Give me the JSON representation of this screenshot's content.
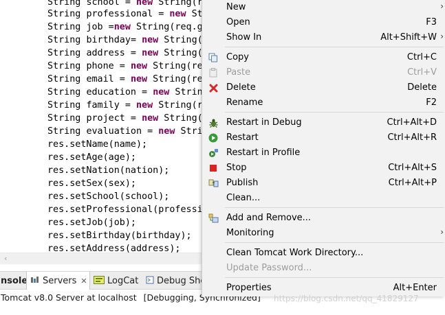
{
  "editor": {
    "lines": [
      {
        "type": "String",
        "name": "school",
        "rest": " = ",
        "kw": "new",
        "tail": " String(r"
      },
      {
        "type": "String",
        "name": "professional",
        "rest": " = ",
        "kw": "new",
        "tail": " St"
      },
      {
        "type": "String",
        "name": "job",
        "rest": " =",
        "kw": "new",
        "tail": " String(req.g"
      },
      {
        "type": "String",
        "name": "birthday",
        "rest": "= ",
        "kw": "new",
        "tail": " String("
      },
      {
        "type": "String",
        "name": "address",
        "rest": " = ",
        "kw": "new",
        "tail": " String("
      },
      {
        "type": "String",
        "name": "phone",
        "rest": " = ",
        "kw": "new",
        "tail": " String(re"
      },
      {
        "type": "String",
        "name": "email",
        "rest": " = ",
        "kw": "new",
        "tail": " String(re"
      },
      {
        "type": "String",
        "name": "education",
        "rest": " = ",
        "kw": "new",
        "tail": " Strin"
      },
      {
        "type": "String",
        "name": "family",
        "rest": " = ",
        "kw": "new",
        "tail": " String(r"
      },
      {
        "type": "String",
        "name": "project",
        "rest": " = ",
        "kw": "new",
        "tail": " String("
      },
      {
        "type": "String",
        "name": "evaluation",
        "rest": " = ",
        "kw": "new",
        "tail": " Stri"
      }
    ],
    "calls": [
      "res.setName(name);",
      "res.setAge(age);",
      "res.setNation(nation);",
      "res.setSex(sex);",
      "res.setSchool(school);",
      "res.setProfessional(professi",
      "res.setJob(job);",
      "res.setBirthday(birthday);",
      "res.setAddress(address);"
    ]
  },
  "tabs": {
    "console": "nsole",
    "servers": "Servers",
    "servers_close": "✕",
    "logcat": "LogCat",
    "debug": "Debug She"
  },
  "status": {
    "server": "Tomcat v8.0 Server at localhost",
    "state": "[Debugging, Synchronized]"
  },
  "menu": {
    "new": {
      "label": "New"
    },
    "open": {
      "label": "Open",
      "accel": "F3"
    },
    "show_in": {
      "label": "Show In",
      "accel": "Alt+Shift+W"
    },
    "copy": {
      "label": "Copy",
      "accel": "Ctrl+C"
    },
    "paste": {
      "label": "Paste",
      "accel": "Ctrl+V"
    },
    "delete": {
      "label": "Delete",
      "accel": "Delete"
    },
    "rename": {
      "label": "Rename",
      "accel": "F2"
    },
    "restart_debug": {
      "label": "Restart in Debug",
      "accel": "Ctrl+Alt+D"
    },
    "restart": {
      "label": "Restart",
      "accel": "Ctrl+Alt+R"
    },
    "restart_profile": {
      "label": "Restart in Profile"
    },
    "stop": {
      "label": "Stop",
      "accel": "Ctrl+Alt+S"
    },
    "publish": {
      "label": "Publish",
      "accel": "Ctrl+Alt+P"
    },
    "clean": {
      "label": "Clean..."
    },
    "add_remove": {
      "label": "Add and Remove..."
    },
    "monitoring": {
      "label": "Monitoring"
    },
    "clean_tomcat": {
      "label": "Clean Tomcat Work Directory..."
    },
    "update_password": {
      "label": "Update Password..."
    },
    "properties": {
      "label": "Properties",
      "accel": "Alt+Enter"
    }
  },
  "watermark": "https://blog.csdn.net/qq_41829127",
  "colors": {
    "keyword": "#7f0055",
    "menu_bg": "#f2f2f2",
    "disabled": "#9d9d9d"
  },
  "icons": {
    "copy": "copy-icon",
    "paste": "paste-icon",
    "delete": "delete-icon",
    "restart_debug": "debug-bug-icon",
    "restart": "play-icon",
    "restart_profile": "profile-icon",
    "stop": "stop-icon",
    "publish": "publish-icon",
    "add_remove": "add-remove-icon"
  }
}
